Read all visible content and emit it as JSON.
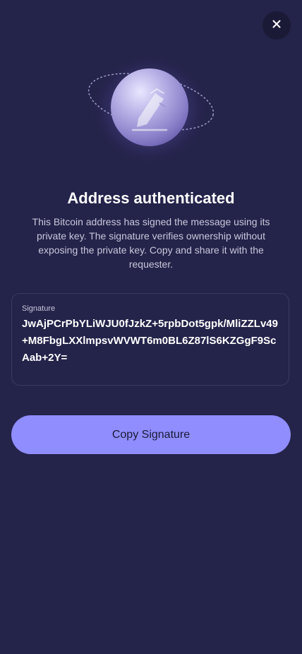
{
  "header": {
    "close_icon": "close-icon"
  },
  "hero": {
    "icon": "pen-signature-icon"
  },
  "content": {
    "title": "Address authenticated",
    "description": "This Bitcoin address has signed the message using its private key. The signature verifies ownership without exposing the private key. Copy and share it with the requester."
  },
  "signature": {
    "label": "Signature",
    "value": "JwAjPCrPbYLiWJU0fJzkZ+5rpbDot5gpk/MliZZLv49+M8FbgLXXlmpsvWVWT6m0BL6Z87lS6KZGgF9ScAab+2Y="
  },
  "actions": {
    "copy_label": "Copy Signature"
  },
  "colors": {
    "background": "#24234a",
    "accent": "#8f8dff",
    "close_bg": "#1b1a36",
    "card_border": "#3a3960"
  }
}
